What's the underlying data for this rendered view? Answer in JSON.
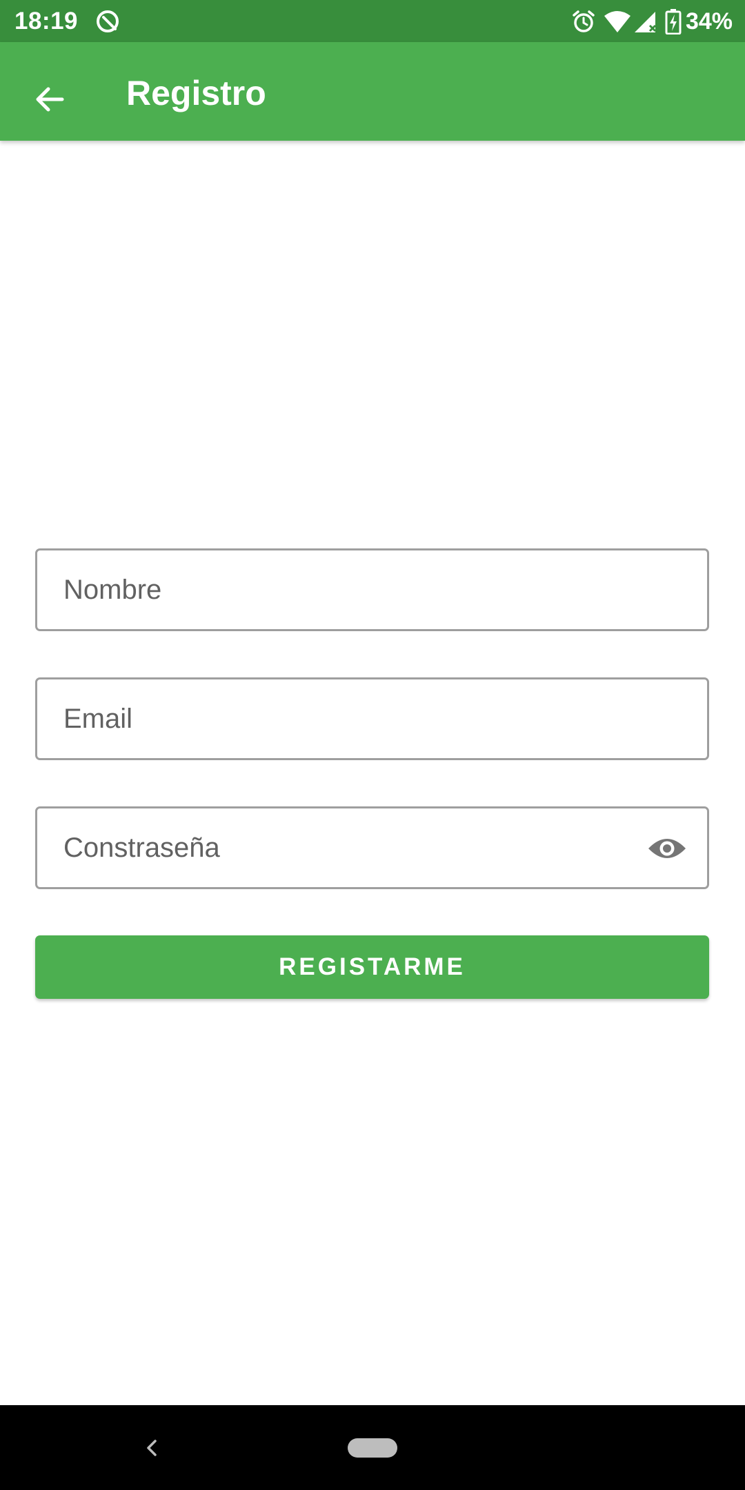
{
  "status_bar": {
    "time": "18:19",
    "battery": "34%",
    "icons": [
      "app-notification-icon",
      "alarm-icon",
      "wifi-icon",
      "cell-signal-icon",
      "battery-charging-icon"
    ]
  },
  "app_bar": {
    "title": "Registro",
    "back_icon": "arrow-back-icon"
  },
  "form": {
    "name_placeholder": "Nombre",
    "name_value": "",
    "email_placeholder": "Email",
    "email_value": "",
    "password_placeholder": "Constraseña",
    "password_value": "",
    "password_toggle_icon": "eye-icon",
    "submit_label": "REGISTARME"
  },
  "nav_bar": {
    "icons": [
      "nav-back-icon",
      "nav-home-pill"
    ]
  },
  "colors": {
    "status_bar": "#388E3C",
    "primary": "#4CAF50",
    "field_border": "#9E9E9E",
    "placeholder": "#616161",
    "background": "#FFFFFF",
    "nav_bar": "#000000"
  }
}
